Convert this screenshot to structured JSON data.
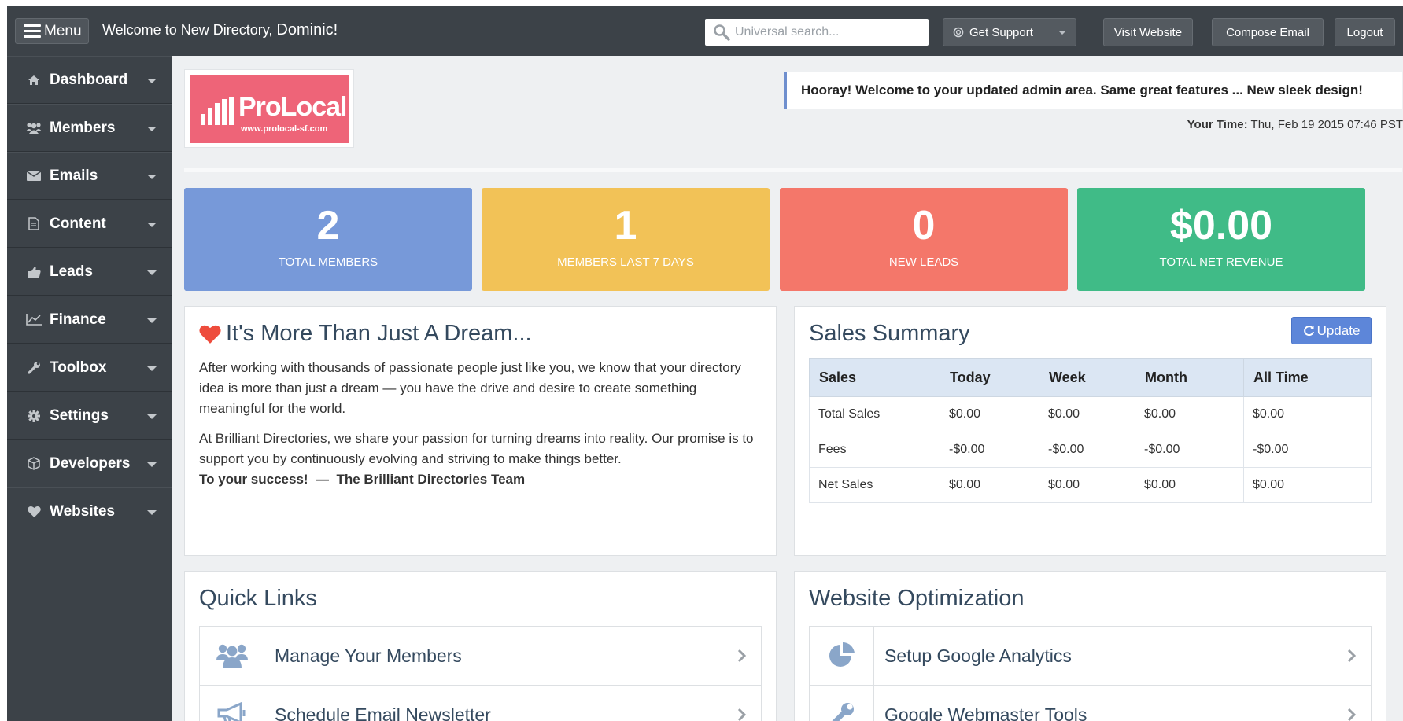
{
  "topbar": {
    "menu_label": "Menu",
    "welcome_text": "Welcome to New Directory,",
    "user_name": "Dominic!",
    "search_placeholder": "Universal search...",
    "support_label": "Get Support",
    "visit_label": "Visit Website",
    "compose_label": "Compose Email",
    "logout_label": "Logout"
  },
  "sidebar": {
    "items": [
      {
        "label": "Dashboard",
        "icon": "home-icon"
      },
      {
        "label": "Members",
        "icon": "users-icon"
      },
      {
        "label": "Emails",
        "icon": "envelope-icon"
      },
      {
        "label": "Content",
        "icon": "file-icon"
      },
      {
        "label": "Leads",
        "icon": "thumbs-up-icon"
      },
      {
        "label": "Finance",
        "icon": "line-chart-icon"
      },
      {
        "label": "Toolbox",
        "icon": "wrench-icon"
      },
      {
        "label": "Settings",
        "icon": "gear-icon"
      },
      {
        "label": "Developers",
        "icon": "cube-icon"
      },
      {
        "label": "Websites",
        "icon": "heart-icon"
      }
    ]
  },
  "logo": {
    "name": "ProLocal",
    "url": "www.prolocal-sf.com"
  },
  "announcement": "Hooray! Welcome to your updated admin area. Same great features ... New sleek design!",
  "time": {
    "label": "Your Time:",
    "value": "Thu, Feb 19 2015 07:46 PST"
  },
  "stats": [
    {
      "value": "2",
      "label": "TOTAL MEMBERS",
      "color": "#7799d9"
    },
    {
      "value": "1",
      "label": "MEMBERS LAST 7 DAYS",
      "color": "#f2c257"
    },
    {
      "value": "0",
      "label": "NEW LEADS",
      "color": "#f4776a"
    },
    {
      "value": "$0.00",
      "label": "TOTAL NET REVENUE",
      "color": "#40bb87"
    }
  ],
  "dream": {
    "title": "It's More Than Just A Dream...",
    "p1": "After working with thousands of passionate people just like you, we know that your directory idea is more than just a dream — you have the drive and desire to create something meaningful for the world.",
    "p2": "At Brilliant Directories, we share your passion for turning dreams into reality. Our promise is to support you by continuously evolving and striving to make things better.",
    "signoff": "To your success!  —  The Brilliant Directories Team"
  },
  "sales": {
    "title": "Sales Summary",
    "update_label": "Update",
    "columns": [
      "Sales",
      "Today",
      "Week",
      "Month",
      "All Time"
    ],
    "rows": [
      [
        "Total Sales",
        "$0.00",
        "$0.00",
        "$0.00",
        "$0.00"
      ],
      [
        "Fees",
        "-$0.00",
        "-$0.00",
        "-$0.00",
        "-$0.00"
      ],
      [
        "Net Sales",
        "$0.00",
        "$0.00",
        "$0.00",
        "$0.00"
      ]
    ]
  },
  "quick_links": {
    "title": "Quick Links",
    "items": [
      {
        "label": "Manage Your Members",
        "icon": "users-icon"
      },
      {
        "label": "Schedule Email Newsletter",
        "icon": "megaphone-icon"
      }
    ]
  },
  "optimization": {
    "title": "Website Optimization",
    "items": [
      {
        "label": "Setup Google Analytics",
        "icon": "pie-chart-icon"
      },
      {
        "label": "Google Webmaster Tools",
        "icon": "wrench-icon"
      }
    ]
  }
}
